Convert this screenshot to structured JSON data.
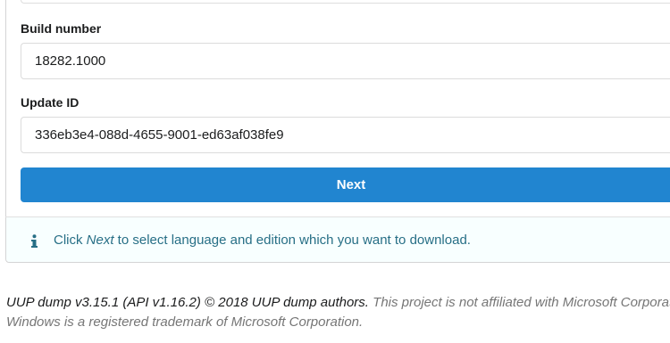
{
  "form": {
    "build_number_label": "Build number",
    "build_number_value": "18282.1000",
    "update_id_label": "Update ID",
    "update_id_value": "336eb3e4-088d-4655-9001-ed63af038fe9",
    "next_label": "Next"
  },
  "info": {
    "icon": "info-icon",
    "text_before": "Click ",
    "text_emphasis": "Next",
    "text_after": " to select language and edition which you want to download."
  },
  "footer": {
    "line1_main": "UUP dump v3.15.1 (API v1.16.2) © 2018 UUP dump authors.",
    "line1_muted": " This project is not affiliated with Microsoft Corporation.",
    "line2": "Windows is a registered trademark of Microsoft Corporation."
  },
  "colors": {
    "accent": "#2185d0",
    "info_text": "#276f86",
    "info_bg": "#f8ffff"
  }
}
